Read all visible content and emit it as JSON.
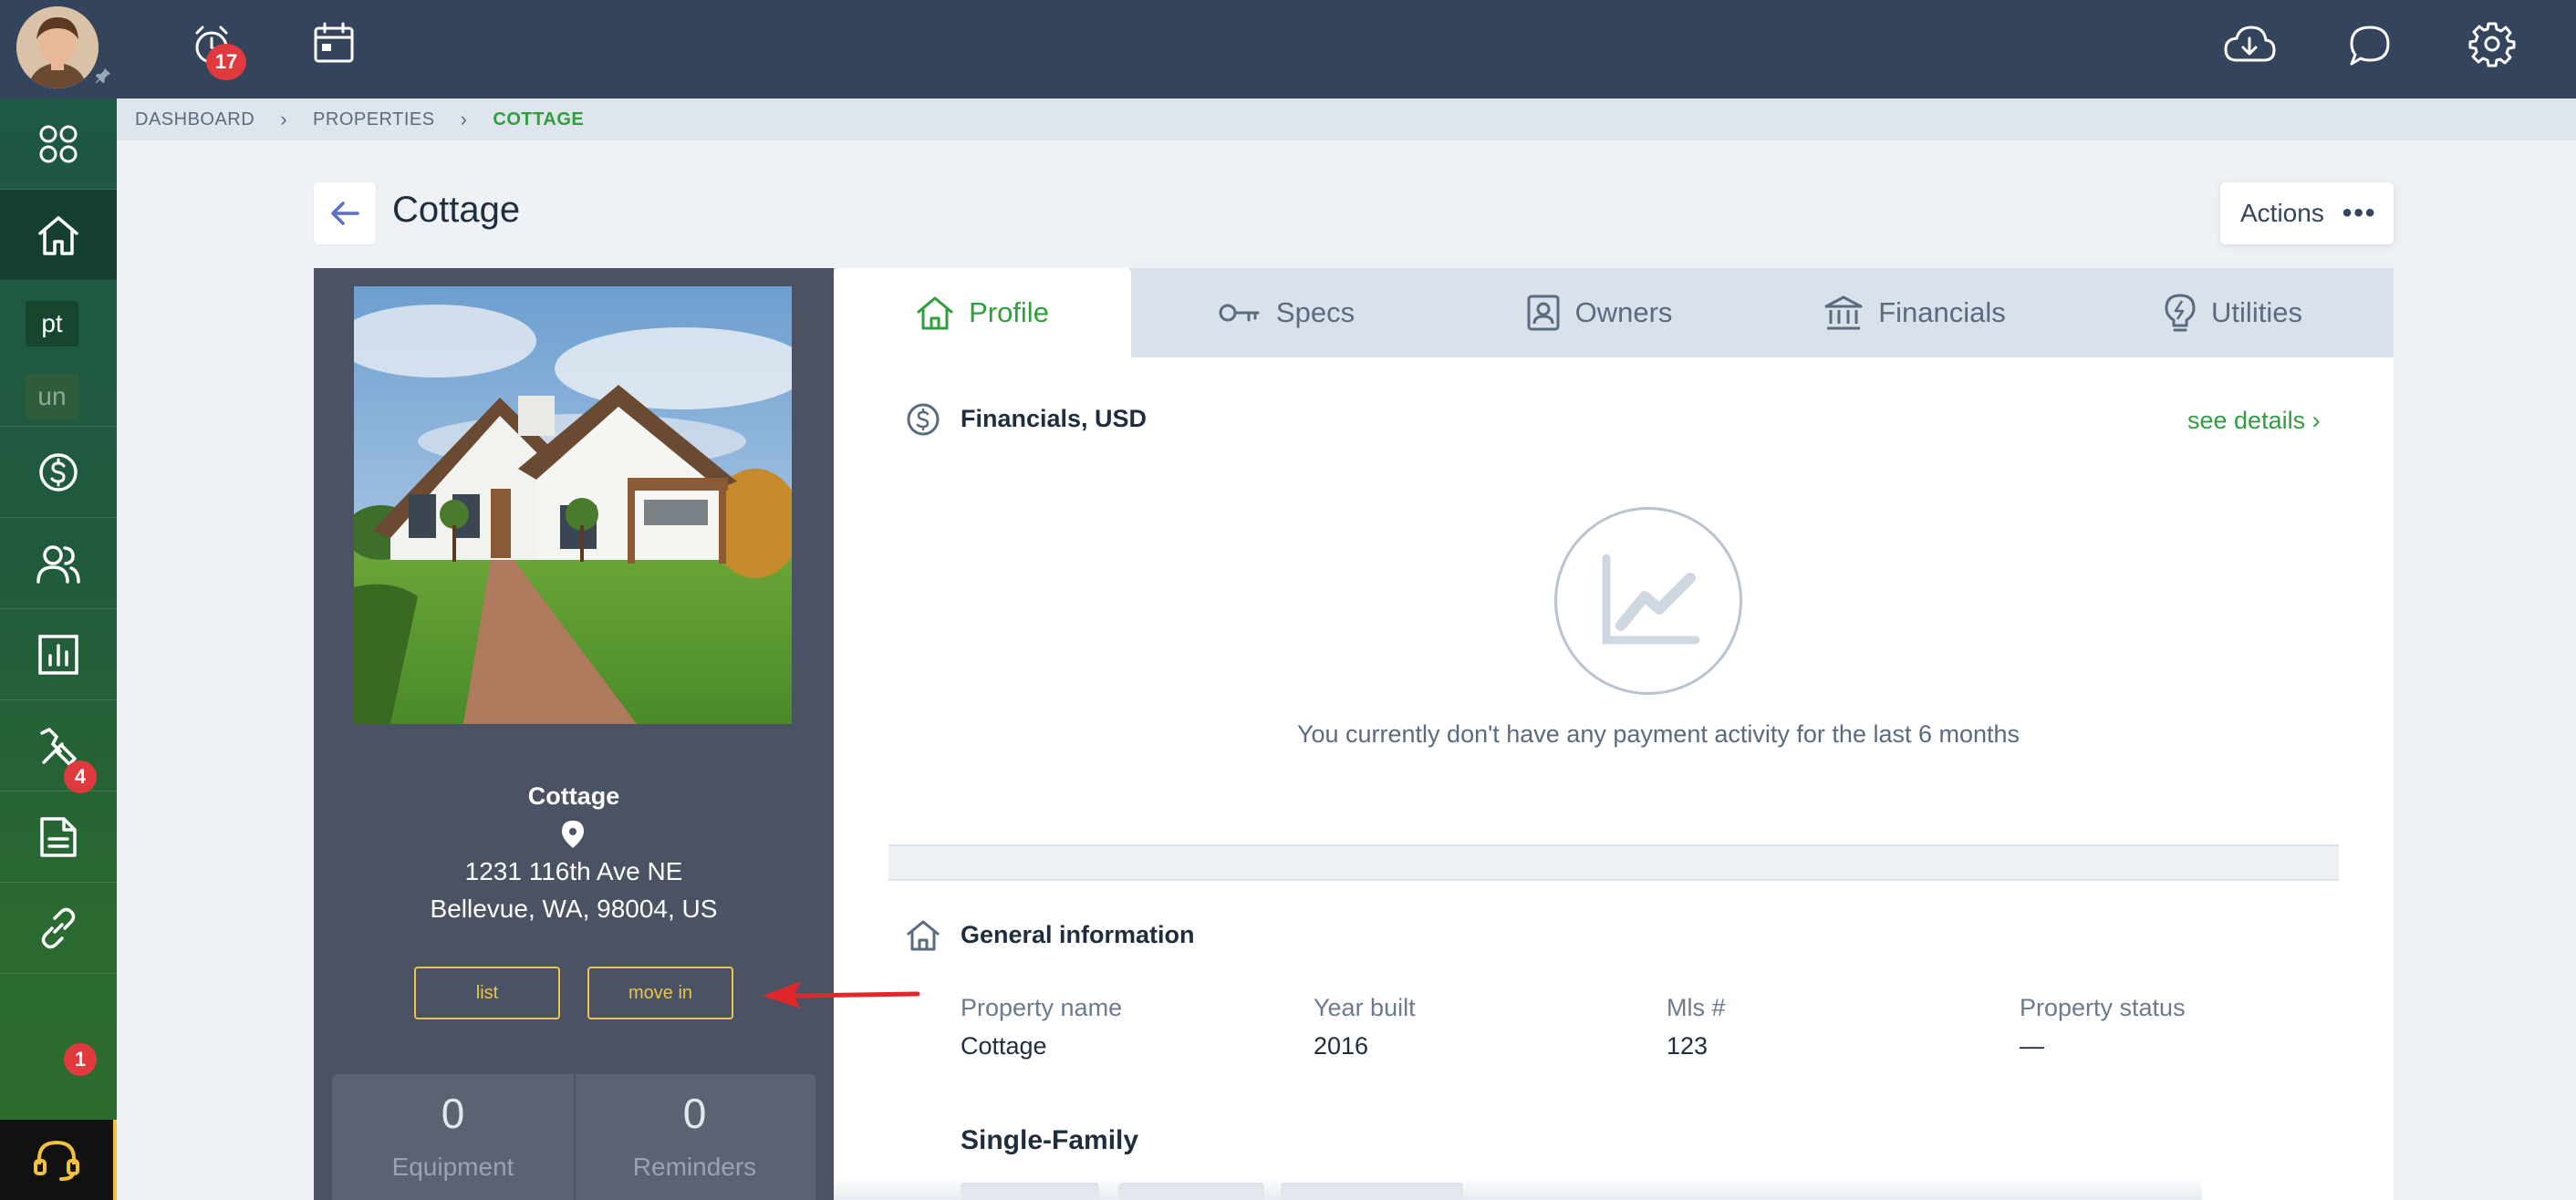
{
  "topbar": {
    "alarm_badge": "17"
  },
  "sidebar": {
    "items": [
      {
        "icon": "apps-grid-icon"
      },
      {
        "icon": "home-icon",
        "active": true
      },
      {
        "label": "pt"
      },
      {
        "label": "un"
      },
      {
        "icon": "dollar-icon"
      },
      {
        "icon": "people-icon"
      },
      {
        "icon": "reports-icon"
      },
      {
        "icon": "tools-icon",
        "badge": "4"
      },
      {
        "icon": "document-icon"
      },
      {
        "icon": "link-icon",
        "badge": "1"
      }
    ]
  },
  "breadcrumb": {
    "items": [
      "DASHBOARD",
      "PROPERTIES"
    ],
    "current": "COTTAGE"
  },
  "page": {
    "title": "Cottage",
    "actions_label": "Actions"
  },
  "property": {
    "name": "Cottage",
    "address_line1": "1231 116th Ave NE",
    "address_line2": "Bellevue, WA, 98004, US",
    "buttons": {
      "list": "list",
      "move_in": "move in"
    },
    "stats": [
      {
        "value": "0",
        "label": "Equipment"
      },
      {
        "value": "0",
        "label": "Reminders"
      }
    ]
  },
  "tabs": [
    {
      "label": "Profile",
      "icon": "home-icon",
      "active": true
    },
    {
      "label": "Specs",
      "icon": "key-icon"
    },
    {
      "label": "Owners",
      "icon": "owner-badge-icon"
    },
    {
      "label": "Financials",
      "icon": "bank-icon"
    },
    {
      "label": "Utilities",
      "icon": "lightbulb-icon"
    }
  ],
  "financials": {
    "title": "Financials, USD",
    "see_details": "see details",
    "empty_message": "You currently don't have any payment activity for the last 6 months"
  },
  "general_info": {
    "title": "General information",
    "fields": [
      {
        "label": "Property name",
        "value": "Cottage"
      },
      {
        "label": "Year built",
        "value": "2016"
      },
      {
        "label": "Mls #",
        "value": "123"
      },
      {
        "label": "Property status",
        "value": "—"
      }
    ],
    "property_type": "Single-Family"
  },
  "colors": {
    "topbar": "#34445c",
    "sidebar": "#1f5a3e",
    "accent_green": "#2e9e3e",
    "button_gold": "#e8c64a",
    "badge_red": "#e0393e",
    "annotation_arrow": "#e0272b"
  }
}
